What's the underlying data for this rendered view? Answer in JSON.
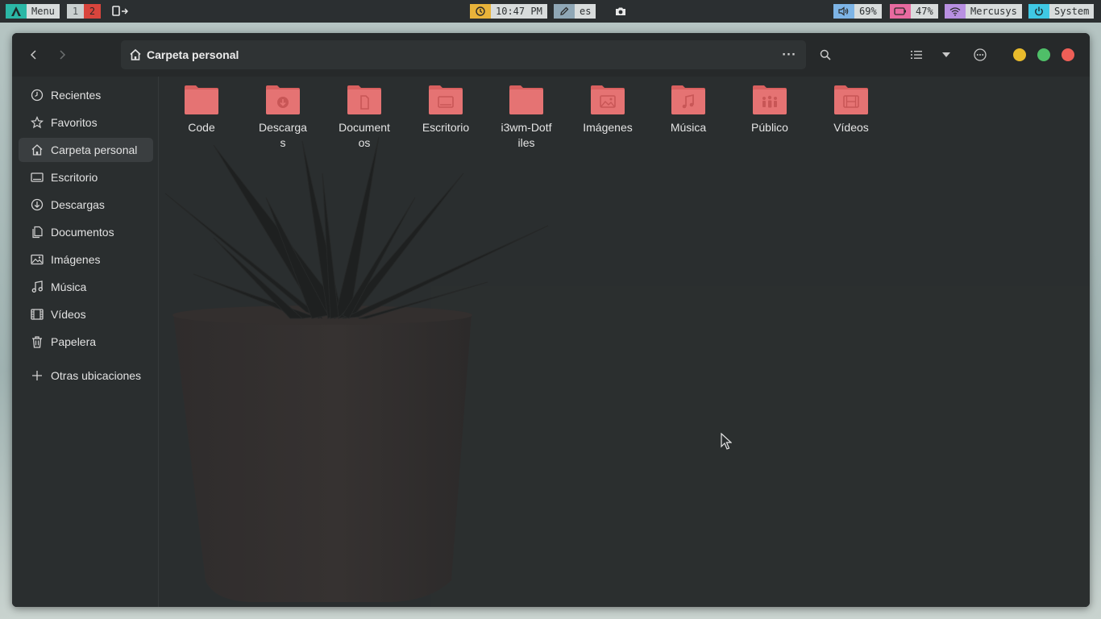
{
  "topbar": {
    "menu_label": "Menu",
    "workspaces": [
      "1",
      "2"
    ],
    "clock": "10:47 PM",
    "keyboard_layout": "es",
    "volume": "69%",
    "battery": "47%",
    "network": "Mercusys",
    "system_label": "System"
  },
  "window": {
    "title": "Carpeta personal",
    "controls": {
      "minimize_color": "#e9bb2c",
      "maximize_color": "#4fbf68",
      "close_color": "#ee5f57"
    }
  },
  "sidebar": {
    "items": [
      {
        "label": "Recientes",
        "icon": "clock-icon"
      },
      {
        "label": "Favoritos",
        "icon": "star-icon"
      },
      {
        "label": "Carpeta personal",
        "icon": "home-icon",
        "active": true
      },
      {
        "label": "Escritorio",
        "icon": "desktop-icon"
      },
      {
        "label": "Descargas",
        "icon": "download-icon"
      },
      {
        "label": "Documentos",
        "icon": "document-icon"
      },
      {
        "label": "Imágenes",
        "icon": "image-icon"
      },
      {
        "label": "Música",
        "icon": "music-icon"
      },
      {
        "label": "Vídeos",
        "icon": "film-icon"
      },
      {
        "label": "Papelera",
        "icon": "trash-icon"
      },
      {
        "label": "Otras ubicaciones",
        "icon": "plus-icon"
      }
    ]
  },
  "folders": [
    {
      "label": "Code",
      "emblem": "none"
    },
    {
      "label": "Descargas",
      "emblem": "download"
    },
    {
      "label": "Documentos",
      "emblem": "document"
    },
    {
      "label": "Escritorio",
      "emblem": "desktop"
    },
    {
      "label": "i3wm-Dotfiles",
      "emblem": "none"
    },
    {
      "label": "Imágenes",
      "emblem": "image"
    },
    {
      "label": "Música",
      "emblem": "music"
    },
    {
      "label": "Público",
      "emblem": "people"
    },
    {
      "label": "Vídeos",
      "emblem": "film"
    }
  ],
  "colors": {
    "folder": "#e57373",
    "folder_back": "#d9605f",
    "accent_menu": "#2bb7a6"
  }
}
